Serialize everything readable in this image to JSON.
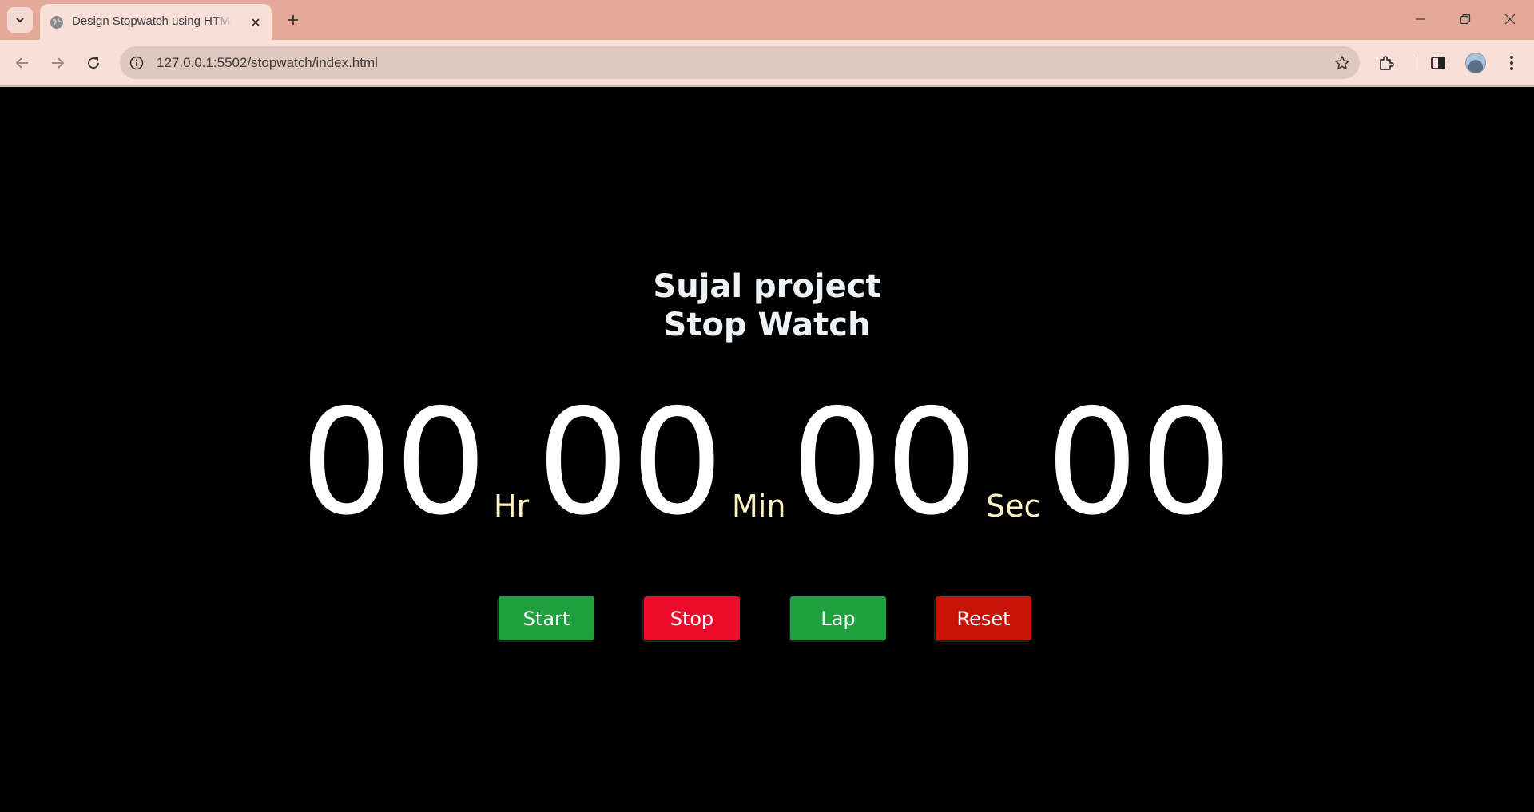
{
  "browser": {
    "tab_title": "Design Stopwatch using HTML C",
    "url": "127.0.0.1:5502/stopwatch/index.html",
    "icons": [
      "chevron-down-icon",
      "globe-icon",
      "close-icon",
      "plus-icon",
      "minimize-icon",
      "restore-icon",
      "close-window-icon",
      "back-icon",
      "forward-icon",
      "reload-icon",
      "info-icon",
      "star-icon",
      "extensions-icon",
      "side-panel-icon",
      "avatar",
      "more-icon"
    ],
    "chrome_color": "#e5a99a"
  },
  "page": {
    "heading_line1": "Sujal project",
    "heading_line2": "Stop Watch",
    "clock": {
      "hours": "00",
      "hours_unit": "Hr",
      "minutes": "00",
      "minutes_unit": "Min",
      "seconds": "00",
      "seconds_unit": "Sec",
      "centiseconds": "00"
    },
    "buttons": {
      "start": "Start",
      "stop": "Stop",
      "lap": "Lap",
      "reset": "Reset"
    },
    "colors": {
      "start": "#1fa140",
      "stop": "#ed0b2c",
      "lap": "#1fa140",
      "reset": "#c71308",
      "unit_text": "#fff1c4"
    }
  }
}
